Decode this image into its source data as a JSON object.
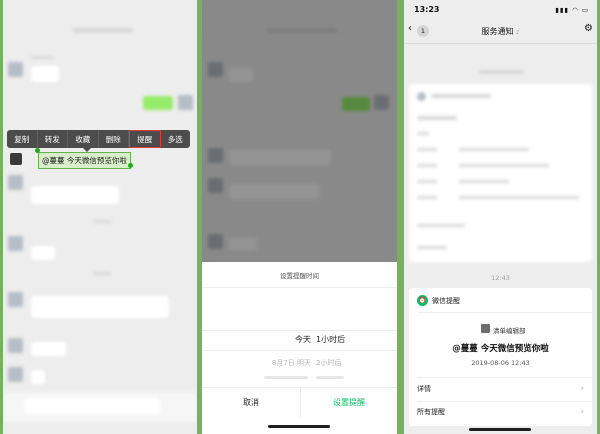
{
  "panel1": {
    "context_menu": [
      "复制",
      "转发",
      "收藏",
      "删除",
      "提醒",
      "多选"
    ],
    "selected_message": "@蔓蔓 今天微信预览你啦"
  },
  "panel2": {
    "sheet_title": "设置提醒时间",
    "picker_selected_day": "今天",
    "picker_selected_time": "1小时后",
    "picker_next_day": "8月7日 明天",
    "picker_next_time": "2小时后",
    "cancel": "取消",
    "confirm": "设置提醒"
  },
  "panel3": {
    "status_time": "13:23",
    "back_badge": "1",
    "title": "服务通知",
    "time_divider": "12:43",
    "reminder_source": "微信提醒",
    "author": "清单编辑部",
    "message": "@蔓蔓 今天微信预览你啦",
    "datetime": "2019-08-06 12:43",
    "details": "详情",
    "all_reminders": "所有提醒"
  },
  "colors": {
    "wechat_green": "#07c160",
    "highlight_red": "#e43a3a"
  }
}
